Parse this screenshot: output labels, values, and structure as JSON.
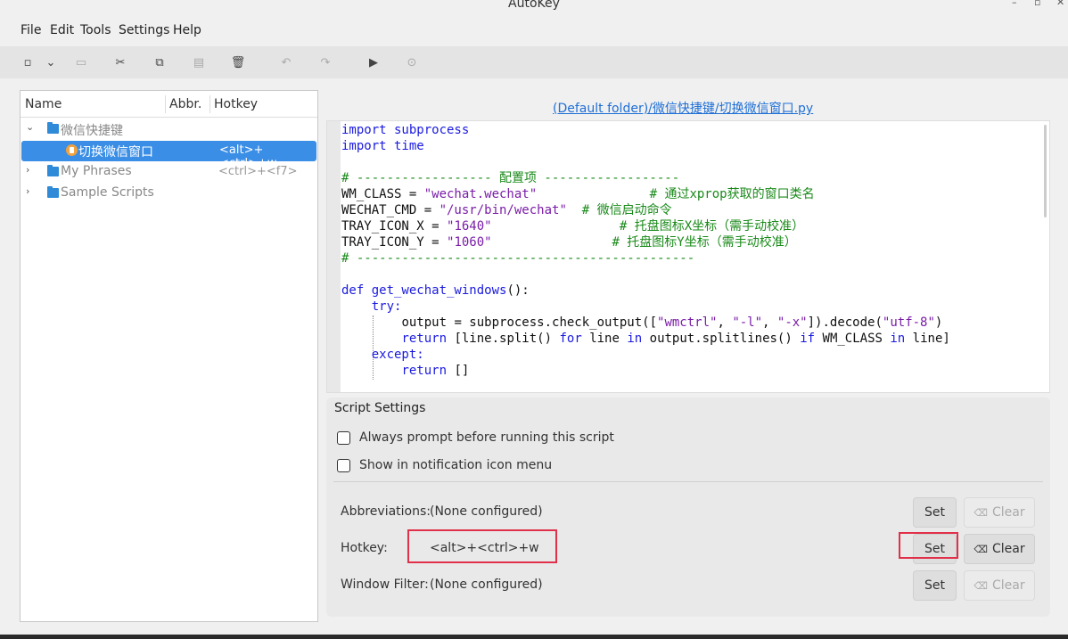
{
  "window": {
    "title": "AutoKey",
    "controls": [
      "–",
      "▫",
      "✕"
    ]
  },
  "menu": {
    "items": [
      "File",
      "Edit",
      "Tools",
      "Settings",
      "Help"
    ]
  },
  "toolbar": {
    "icons": [
      "new-icon",
      "dropdown-icon",
      "new-folder-icon",
      "cut-icon",
      "copy-icon",
      "paste-icon",
      "delete-icon",
      "undo-icon",
      "redo-icon",
      "run-icon",
      "record-icon"
    ]
  },
  "tree": {
    "columns": [
      "Name",
      "Abbr.",
      "Hotkey"
    ],
    "rows": [
      {
        "label": "微信快捷键",
        "hotkey": "",
        "type": "folder",
        "expanded": true
      },
      {
        "label": "切换微信窗口",
        "hotkey": "<alt>+<ctrl>+w",
        "type": "script",
        "selected": true
      },
      {
        "label": "My Phrases",
        "hotkey": "<ctrl>+<f7>",
        "type": "folder"
      },
      {
        "label": "Sample Scripts",
        "hotkey": "",
        "type": "folder"
      }
    ]
  },
  "path": {
    "link": "(Default folder)/微信快捷键/切换微信窗口.py"
  },
  "code": {
    "l1": "import subprocess",
    "l2": "import time",
    "l4": "# ------------------ 配置项 ------------------",
    "l5a": "WM_CLASS = ",
    "l5b": "\"wechat.wechat\"",
    "l5c": "               # 通过xprop获取的窗口类名",
    "l6a": "WECHAT_CMD = ",
    "l6b": "\"/usr/bin/wechat\"",
    "l6c": "  # 微信启动命令",
    "l7a": "TRAY_ICON_X = ",
    "l7b": "\"1640\"",
    "l7c": "                 # 托盘图标X坐标（需手动校准）",
    "l8a": "TRAY_ICON_Y = ",
    "l8b": "\"1060\"",
    "l8c": "                # 托盘图标Y坐标（需手动校准）",
    "l9": "# ---------------------------------------------",
    "l11a": "def ",
    "l11b": "get_wechat_windows",
    "l11c": "():",
    "l12": "try:",
    "l13a": "output = subprocess.check_output([",
    "l13b": "\"wmctrl\"",
    "l13c": ", ",
    "l13d": "\"-l\"",
    "l13e": ", ",
    "l13f": "\"-x\"",
    "l13g": "]).decode(",
    "l13h": "\"utf-8\"",
    "l13i": ")",
    "l14a": "return ",
    "l14b": "[line.split() ",
    "l14c": "for ",
    "l14d": "line ",
    "l14e": "in ",
    "l14f": "output.splitlines() ",
    "l14g": "if ",
    "l14h": "WM_CLASS ",
    "l14i": "in ",
    "l14j": "line]",
    "l15": "except:",
    "l16a": "return ",
    "l16b": "[]"
  },
  "settings": {
    "title": "Script Settings",
    "always_prompt": "Always prompt before running this script",
    "show_notification": "Show in notification icon menu",
    "abbreviations_label": "Abbreviations:",
    "abbreviations_value": "(None configured)",
    "hotkey_label": "Hotkey:",
    "hotkey_value": "<alt>+<ctrl>+w",
    "window_filter_label": "Window Filter:",
    "window_filter_value": "(None configured)",
    "set_label": "Set",
    "clear_label": "Clear"
  },
  "colors": {
    "selection": "#3a8ee6",
    "highlight": "#e0304a",
    "link": "#1f6fd6"
  }
}
